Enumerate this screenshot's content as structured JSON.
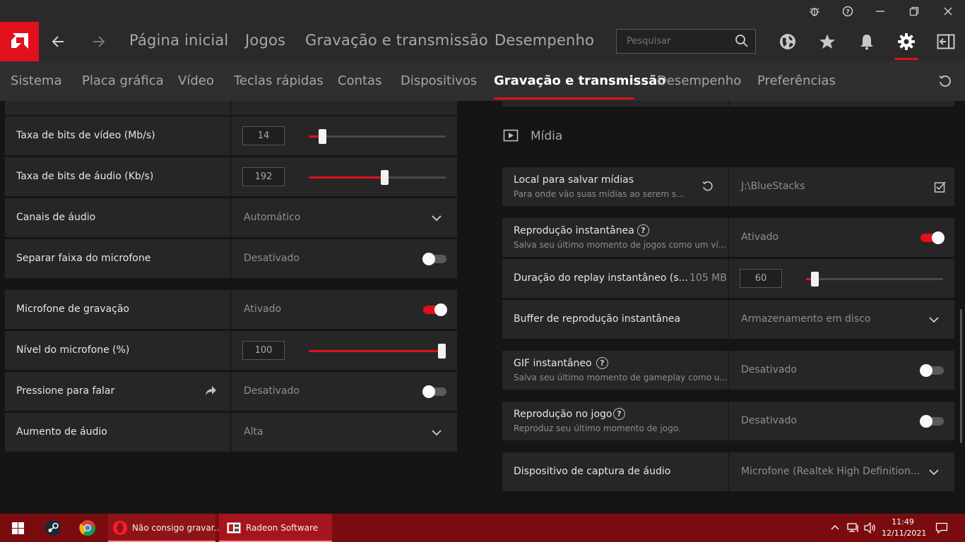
{
  "topnav": {
    "items": [
      "Página inicial",
      "Jogos",
      "Gravação e transmissão",
      "Desempenho"
    ],
    "search_placeholder": "Pesquisar"
  },
  "subnav": {
    "items": [
      "Sistema",
      "Placa gráfica",
      "Vídeo",
      "Teclas rápidas",
      "Contas",
      "Dispositivos",
      "Gravação e transmissão",
      "Desempenho",
      "Preferências"
    ],
    "active_index": 6
  },
  "left": {
    "video_bitrate": {
      "label": "Taxa de bits de vídeo (Mb/s)",
      "value": "14",
      "level": 0.1
    },
    "audio_bitrate": {
      "label": "Taxa de bits de áudio (Kb/s)",
      "value": "192",
      "level": 0.55
    },
    "audio_channels": {
      "label": "Canais de áudio",
      "value": "Automático"
    },
    "separate_mic": {
      "label": "Separar faixa do microfone",
      "value": "Desativado"
    },
    "record_mic": {
      "label": "Microfone de gravação",
      "value": "Ativado"
    },
    "mic_level": {
      "label": "Nível do microfone (%)",
      "value": "100",
      "level": 1.0
    },
    "push_to_talk": {
      "label": "Pressione para falar",
      "value": "Desativado"
    },
    "audio_boost": {
      "label": "Aumento de áudio",
      "value": "Alta"
    }
  },
  "right": {
    "section_title": "Mídia",
    "save_location": {
      "title": "Local para salvar mídias",
      "subtitle": "Para onde vão suas mídias ao serem s...",
      "value": "J:\\BlueStacks"
    },
    "instant_replay": {
      "title": "Reprodução instantânea",
      "subtitle": "Salva seu último momento de jogos como um ví...",
      "value": "Ativado"
    },
    "replay_duration": {
      "title": "Duração do replay instantâneo (s...",
      "size": "105 MB",
      "value": "60",
      "level": 0.06
    },
    "replay_buffer": {
      "title": "Buffer de reprodução instantânea",
      "value": "Armazenamento em disco"
    },
    "instant_gif": {
      "title": "GIF instantâneo",
      "subtitle": "Salva seu último momento de gameplay como u...",
      "value": "Desativado"
    },
    "in_game_replay": {
      "title": "Reprodução no jogo",
      "subtitle": "Reproduz seu último momento de jogo.",
      "value": "Desativado"
    },
    "audio_capture": {
      "title": "Dispositivo de captura de áudio",
      "value": "Microfone (Realtek High Definition..."
    }
  },
  "taskbar": {
    "opera_window": "Não consigo gravar...",
    "radeon_window": "Radeon Software",
    "time": "11:49",
    "date": "12/11/2021"
  },
  "colors": {
    "accent": "#e0101c",
    "taskbar": "#7a0c10"
  }
}
